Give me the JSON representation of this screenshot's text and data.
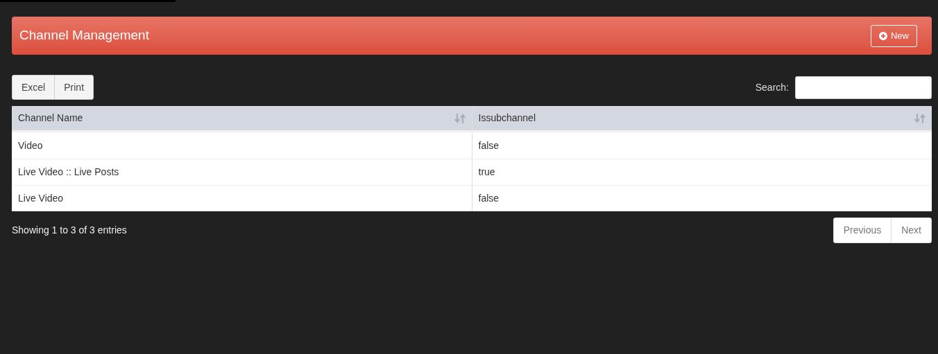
{
  "panel": {
    "title": "Channel Management",
    "new_button": "New"
  },
  "export_buttons": [
    "Excel",
    "Print"
  ],
  "search": {
    "label": "Search:"
  },
  "table": {
    "columns": [
      "Channel Name",
      "Issubchannel"
    ],
    "rows": [
      [
        "Video",
        "false"
      ],
      [
        "Live Video :: Live Posts",
        "true"
      ],
      [
        "Live Video",
        "false"
      ]
    ]
  },
  "info": "Showing 1 to 3 of 3 entries",
  "pagination": [
    "Previous",
    "Next"
  ]
}
